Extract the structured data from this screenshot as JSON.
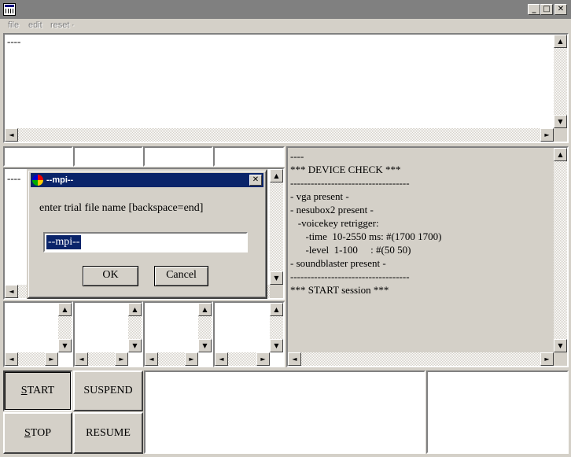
{
  "window": {
    "minimize_glyph": "_",
    "maximize_glyph": "□",
    "close_glyph": "✕"
  },
  "menu": {
    "items": [
      "file",
      "edit",
      "reset"
    ],
    "reset_arrow": "·"
  },
  "top_log": {
    "text": "----"
  },
  "left_log": {
    "text": "----"
  },
  "device_log": {
    "lines": [
      "----",
      "*** DEVICE CHECK ***",
      "-----------------------------------",
      "- vga present -",
      "- nesubox2 present -",
      "   -voicekey retrigger:",
      "      -time  10-2550 ms: #(1700 1700)",
      "      -level  1-100     : #(50 50)",
      "- soundblaster present -",
      "-----------------------------------",
      "*** START session ***"
    ]
  },
  "controls": {
    "start_label": "START",
    "start_mnemonic": "S",
    "suspend_label": "SUSPEND",
    "stop_label": "STOP",
    "stop_mnemonic": "S",
    "resume_label": "RESUME"
  },
  "dialog": {
    "title": "--mpi--",
    "prompt": "enter trial file name [backspace=end]",
    "input_value": "--mpi--",
    "ok_label": "OK",
    "cancel_label": "Cancel",
    "close_glyph": "✕"
  },
  "icons": {
    "up": "▲",
    "down": "▼",
    "left": "◄",
    "right": "►"
  },
  "colors": {
    "face": "#d4d0c8",
    "dialog_title": "#0a246a",
    "inactive_title": "#808080",
    "selection": "#0a246a"
  }
}
